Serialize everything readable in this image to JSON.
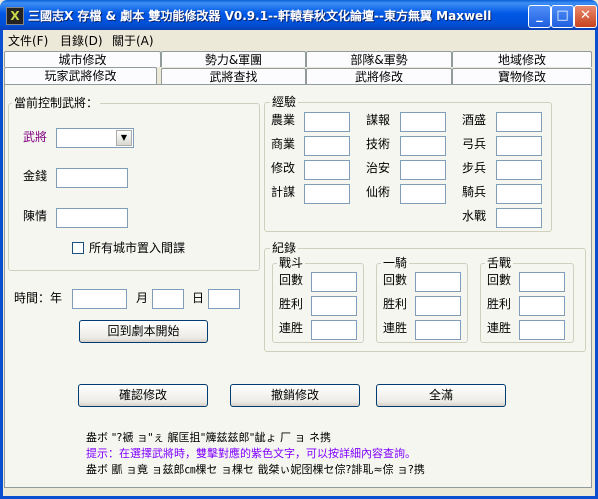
{
  "window": {
    "title": "三國志X 存檔 & 劇本 雙功能修改器 V0.9.1--軒轅春秋文化論壇--東方無翼 Maxwell",
    "icon_glyph": "X",
    "minimize": "_",
    "maximize": "□",
    "close": "✕"
  },
  "menu": [
    "文件(F)",
    "目錄(D)",
    "關于(A)"
  ],
  "tabs_row1": [
    "城市修改",
    "勢力&軍團",
    "部隊&軍勢",
    "地域修改"
  ],
  "tabs_row2": [
    "玩家武將修改",
    "武將查找",
    "武將修改",
    "寶物修改"
  ],
  "control": {
    "group_label": "當前控制武將：",
    "general_label": "武將",
    "gold_label": "金錢",
    "spies_label": "陳情",
    "checkbox_label": "所有城市置入間諜",
    "checkbox_checked": false
  },
  "experience": {
    "group_label": "經驗",
    "col1": [
      "農業",
      "商業",
      "修改",
      "計謀"
    ],
    "col2": [
      "謀報",
      "技術",
      "治安",
      "仙術"
    ],
    "col3": [
      "酒盛",
      "弓兵",
      "步兵",
      "騎兵",
      "水戰"
    ]
  },
  "records": {
    "group_label": "紀錄",
    "battle": {
      "label": "戰斗",
      "rows": [
        "回數",
        "胜利",
        "連胜"
      ]
    },
    "duel": {
      "label": "一騎",
      "rows": [
        "回數",
        "胜利",
        "連胜"
      ]
    },
    "debate": {
      "label": "舌戰",
      "rows": [
        "回數",
        "胜利",
        "連胜"
      ]
    }
  },
  "time": {
    "label": "時間：年",
    "month": "月",
    "day": "日"
  },
  "buttons": {
    "return_start": "回到劇本開始",
    "confirm": "確認修改",
    "cancel": "撤銷修改",
    "max": "全滿"
  },
  "status": {
    "line1": "盎ボ  \"?褫  ョ\"ぇ   艉匡抯\"簰兹兹郎\"龇ょ  厂  ョ ネ携",
    "hint": "提示：在選擇武將時，雙擊對應的紫色文字，可以按詳細內容查詢。",
    "line3": "盎ボ  爴   ョ竟    ョ兹郎㎝棵セ    ョ棵セ  戠桀ぃ妮囹棵セ倧?誹耴≈倧  ョ?携"
  },
  "colors": {
    "accent_purple": "#800080",
    "hint": "#8000ff",
    "title_bar": "#0058e6"
  }
}
